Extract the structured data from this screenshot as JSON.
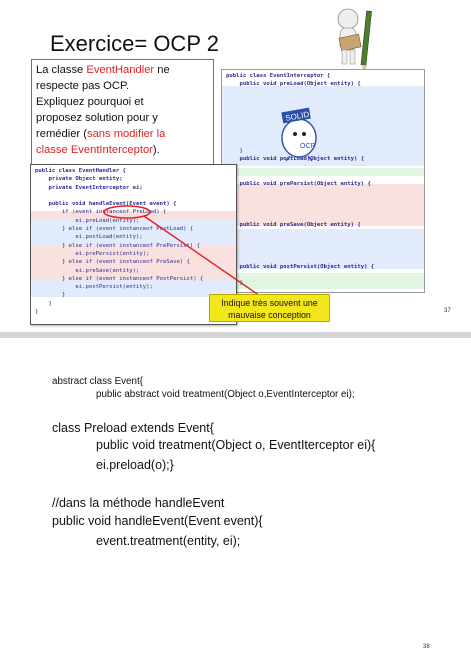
{
  "slide1": {
    "title": "Exercice= OCP 2",
    "box_lines": [
      {
        "a": "La classe ",
        "b": "EventHandler",
        "c": " ne"
      },
      {
        "a": "respecte pas OCP.",
        "b": "",
        "c": ""
      },
      {
        "a": "Expliquez pourquoi et",
        "b": "",
        "c": ""
      },
      {
        "a": "proposez solution pour y",
        "b": "",
        "c": ""
      },
      {
        "a": "remédier (",
        "b": "sans modifier la",
        "c": ""
      },
      {
        "a": "",
        "b": "classe EventInterceptor",
        "c": ")."
      }
    ],
    "right_code": [
      "public class EventInterceptor {",
      "    public void preLoad(Object entity) {",
      "",
      "",
      "",
      "",
      "",
      "",
      "",
      "    }",
      "    public void postLoad(Object entity) {",
      "",
      "",
      "    public void prePersist(Object entity) {",
      "",
      "",
      "",
      "",
      "    public void preSave(Object entity) {",
      "",
      "",
      "",
      "",
      "    public void postPersist(Object entity) {",
      "",
      "    }",
      "}"
    ],
    "left_code": [
      "public class EventHandler {",
      "    private Object entity;",
      "    private EventInterceptor ei;",
      "",
      "    public void handleEvent(Event event) {",
      "        if (event instanceof PreLoad) {",
      "            ei.preLoad(entity);",
      "        } else if (event instanceof PostLoad) {",
      "            ei.postLoad(entity);",
      "        } else if (event instanceof PrePersist) {",
      "            ei.prePersist(entity);",
      "        } else if (event instanceof PreSave) {",
      "            ei.preSave(entity);",
      "        } else if (event instanceof PostPersist) {",
      "            ei.postPersist(entity);",
      "        }",
      "    }",
      "}"
    ],
    "solid_badge": "SOLID",
    "ocp_badge": "OCP",
    "callout": "Indique très souvent une mauvaise conception",
    "page_number": "37"
  },
  "slide2": {
    "lines": [
      {
        "text": "abstract class Event{",
        "indent": 0,
        "size": "small"
      },
      {
        "text": "public abstract void treatment(Object o,EventInterceptor ei);",
        "indent": 1,
        "size": "small"
      },
      {
        "text": "class Preload extends Event{",
        "indent": 0,
        "size": "large"
      },
      {
        "text": "public void treatment(Object o, EventIterceptor ei){",
        "indent": 1,
        "size": "large"
      },
      {
        "text": "ei.preload(o);}",
        "indent": 1,
        "size": "large"
      },
      {
        "text": "//dans la méthode handleEvent",
        "indent": 0,
        "size": "large"
      },
      {
        "text": "public void handleEvent(Event event){",
        "indent": 0,
        "size": "large"
      },
      {
        "text": "event.treatment(entity, ei);",
        "indent": 1,
        "size": "large"
      }
    ],
    "page_number": "38"
  },
  "colors": {
    "accent_red": "#e02222",
    "box_border": "#1aa34a",
    "callout_bg": "#f3e61a",
    "highlight_red": "#fbe0e0",
    "highlight_blue": "#e2ebfb",
    "highlight_green": "#e1f6e1"
  }
}
